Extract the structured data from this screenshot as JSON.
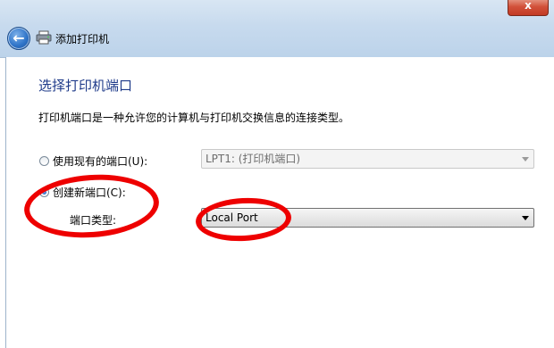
{
  "window": {
    "close_label": "x",
    "nav_title": "添加打印机"
  },
  "page": {
    "heading": "选择打印机端口",
    "description": "打印机端口是一种允许您的计算机与打印机交换信息的连接类型。"
  },
  "existing_port": {
    "label": "使用现有的端口(U):",
    "selected": false,
    "value": "LPT1: (打印机端口)"
  },
  "new_port": {
    "label": "创建新端口(C):",
    "selected": true,
    "type_label": "端口类型:",
    "type_value": "Local Port"
  },
  "colors": {
    "heading": "#1f3b8a",
    "annotation": "#ee0000"
  }
}
